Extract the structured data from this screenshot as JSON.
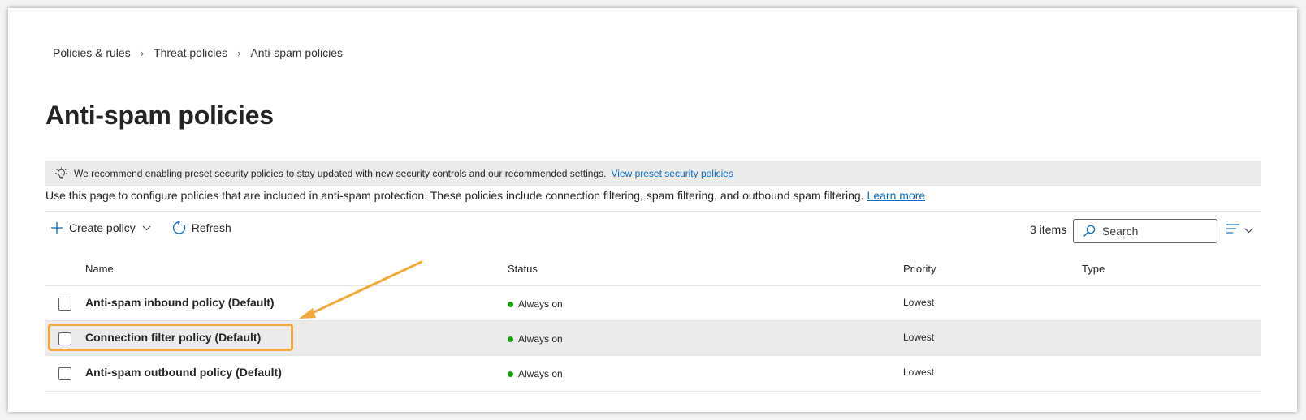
{
  "breadcrumb": [
    "Policies & rules",
    "Threat policies",
    "Anti-spam policies"
  ],
  "page_title": "Anti-spam policies",
  "banner": {
    "icon": "lightbulb-icon",
    "text": "We recommend enabling preset security policies to stay updated with new security controls and our recommended settings.",
    "link": "View preset security policies"
  },
  "description": {
    "text": "Use this page to configure policies that are included in anti-spam protection. These policies include connection filtering, spam filtering, and outbound spam filtering.",
    "link": "Learn more"
  },
  "toolbar": {
    "create_label": "Create policy",
    "refresh_label": "Refresh",
    "item_count": "3 items",
    "search_placeholder": "Search"
  },
  "table": {
    "columns": [
      "Name",
      "Status",
      "Priority",
      "Type"
    ],
    "rows": [
      {
        "name": "Anti-spam inbound policy (Default)",
        "status": "Always on",
        "priority": "Lowest",
        "type": ""
      },
      {
        "name": "Connection filter policy (Default)",
        "status": "Always on",
        "priority": "Lowest",
        "type": ""
      },
      {
        "name": "Anti-spam outbound policy (Default)",
        "status": "Always on",
        "priority": "Lowest",
        "type": ""
      }
    ]
  },
  "colors": {
    "accent_link": "#0f6cbd",
    "status_on": "#13a10e",
    "highlight": "#f2a93b",
    "selected_row": "#ebebeb"
  }
}
